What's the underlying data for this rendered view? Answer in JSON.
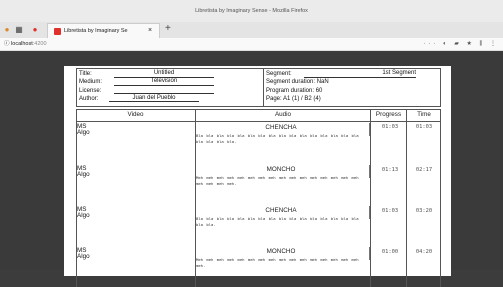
{
  "window": {
    "title": "Libretista by Imaginary Sense - Mozilla Firefox"
  },
  "tab": {
    "title": "Libretista by Imaginary Se",
    "close": "×",
    "new": "+"
  },
  "nav": {
    "host": "localhost",
    "port": ":4200",
    "icons": "··· ◐ ▰ ★ ⫼ ⋮"
  },
  "header": {
    "title_label": "Title:",
    "title_value": "Untitled",
    "medium_label": "Medium:",
    "medium_value": "Television",
    "license_label": "License:",
    "license_value": "",
    "author_label": "Author:",
    "author_value": "Juan del Pueblo",
    "segment_label": "Segment:",
    "segment_value": "1st Segment",
    "segment_duration": "Segment duration: NaN",
    "program_duration": "Program duration: 60",
    "page": "Page: A1 (1) / B2 (4)"
  },
  "columns": {
    "video": "Video",
    "audio": "Audio",
    "progress": "Progress",
    "time": "Time"
  },
  "rows": [
    {
      "video1": "MS",
      "video2": "Algo",
      "name": "CHENCHA",
      "text": "Bla bla bla bla bla bla bla bla bla bla bla bla bla bla bla bla bla bla bla bla.",
      "progress": "01:03",
      "time": "01:03"
    },
    {
      "video1": "MS",
      "video2": "Algo",
      "name": "MONCHO",
      "text": "Meh meh meh meh meh meh meh meh meh meh meh meh meh meh meh meh meh meh meh meh.",
      "progress": "01:13",
      "time": "02:17"
    },
    {
      "video1": "MS",
      "video2": "Algo",
      "name": "CHENCHA",
      "text": "Bla bla bla bla bla bla bla bla bla bla bla bla bla bla bla bla bla bla.",
      "progress": "01:03",
      "time": "03:20"
    },
    {
      "video1": "MS",
      "video2": "Algo",
      "name": "MONCHO",
      "text": "Meh meh meh meh meh meh meh meh meh meh meh meh meh meh meh meh meh.",
      "progress": "01:00",
      "time": "04:20"
    }
  ]
}
